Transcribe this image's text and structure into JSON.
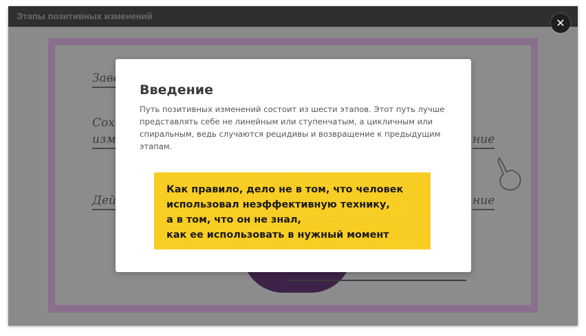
{
  "window": {
    "title": "Этапы позитивных изменений"
  },
  "background": {
    "labels": [
      "Заве",
      "Сохр",
      "изме",
      "ние",
      "Дейс",
      "ние"
    ]
  },
  "modal": {
    "title": "Введение",
    "body_lines": [
      "Путь позитивных изменений состоит из шести этапов. Этот путь лучше",
      "представлять себе не линейным или ступенчатым, а цикличным или",
      "спиральным, ведь случаются рецидивы и возвращение к предыдущим",
      "этапам."
    ],
    "quote_lines": [
      "Как правило, дело не в том, что человек",
      "использовал неэффективную технику,",
      "а в том, что он не знал,",
      "как ее использовать в нужный момент"
    ]
  },
  "controls": {
    "close_icon": "close-icon",
    "close_glyph": "✕"
  },
  "colors": {
    "titlebar": "#2f2f2f",
    "overlay": "#8a8a8a",
    "quote_bg": "#f8cc1e",
    "accent_purple": "#3d2348"
  }
}
